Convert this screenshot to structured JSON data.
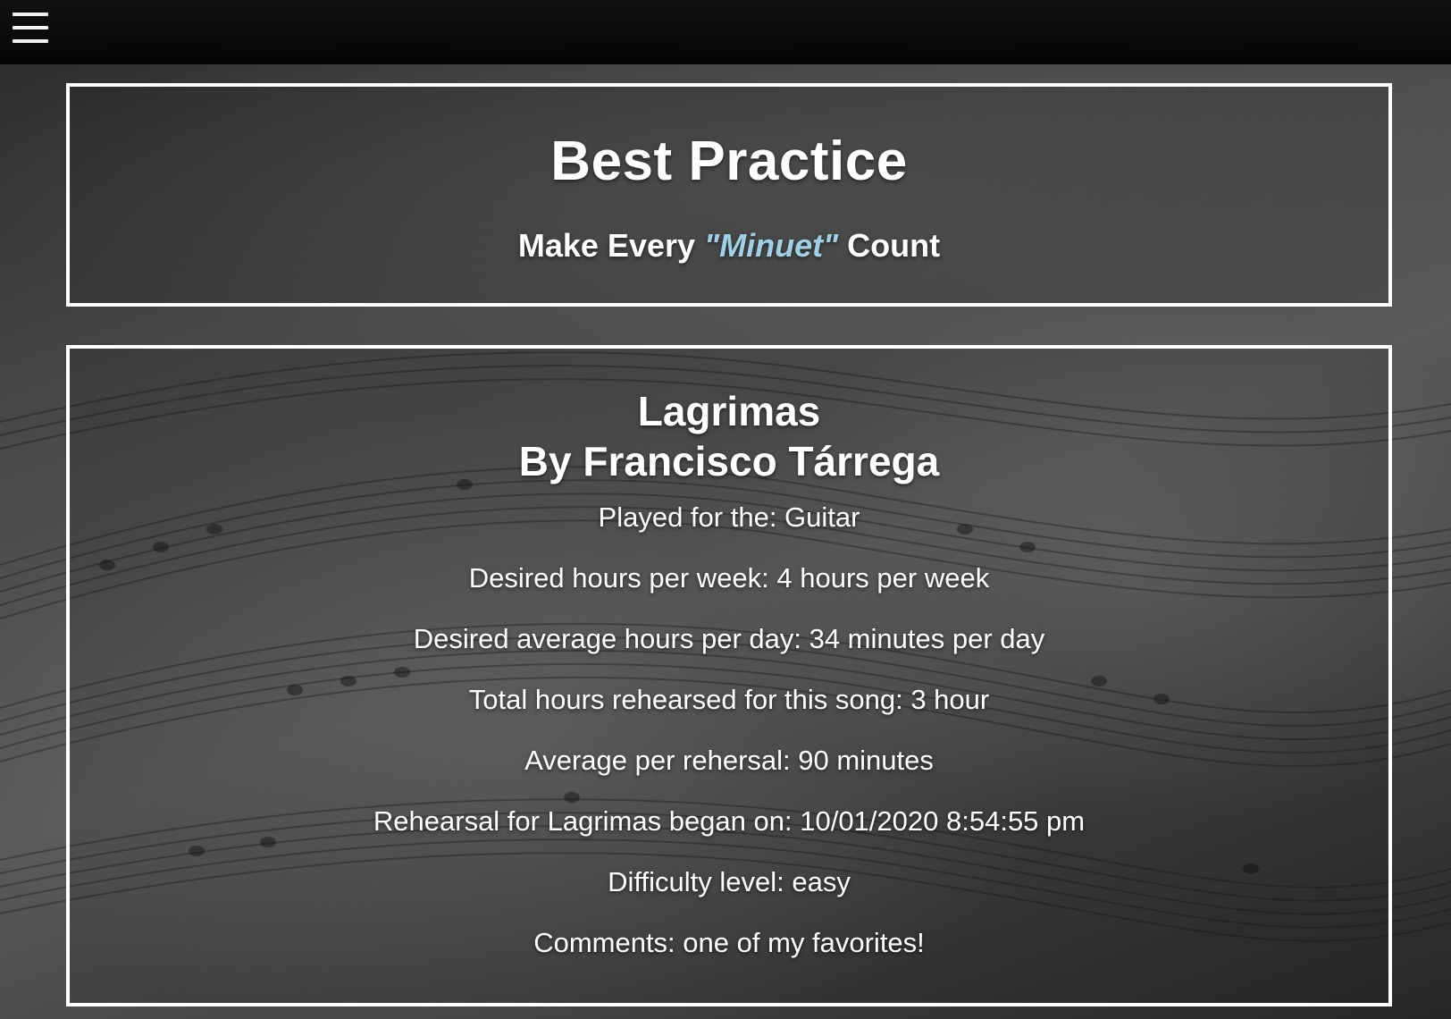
{
  "nav": {
    "menu_icon": "hamburger-menu-icon"
  },
  "header": {
    "title": "Best Practice",
    "tagline_before": "Make Every ",
    "tagline_accent": "\"Minuet\"",
    "tagline_after": " Count",
    "accent_color": "#9fd0e6"
  },
  "song": {
    "title": "Lagrimas",
    "composer_line": "By Francisco Tárrega",
    "details": [
      "Played for the: Guitar",
      "Desired hours per week: 4 hours per week",
      "Desired average hours per day: 34 minutes per day",
      "Total hours rehearsed for this song: 3 hour",
      "Average per rehersal: 90 minutes",
      "Rehearsal for Lagrimas began on: 10/01/2020 8:54:55 pm",
      "Difficulty level: easy",
      "Comments: one of my favorites!"
    ]
  }
}
